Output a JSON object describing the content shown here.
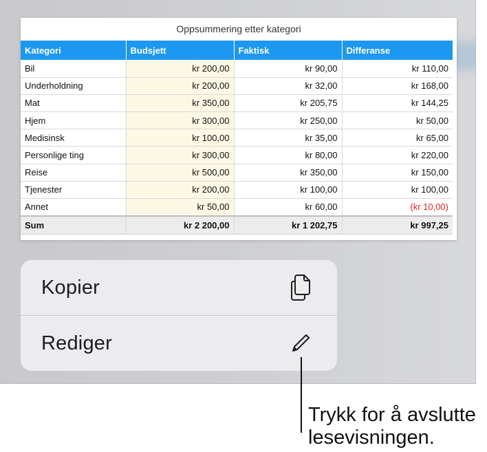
{
  "table": {
    "title": "Oppsummering etter kategori",
    "columns": [
      "Kategori",
      "Budsjett",
      "Faktisk",
      "Differanse"
    ],
    "rows": [
      {
        "category": "Bil",
        "budget": "kr 200,00",
        "actual": "kr 90,00",
        "difference": "kr 110,00"
      },
      {
        "category": "Underholdning",
        "budget": "kr 200,00",
        "actual": "kr 32,00",
        "difference": "kr 168,00"
      },
      {
        "category": "Mat",
        "budget": "kr 350,00",
        "actual": "kr 205,75",
        "difference": "kr 144,25"
      },
      {
        "category": "Hjem",
        "budget": "kr 300,00",
        "actual": "kr 250,00",
        "difference": "kr 50,00"
      },
      {
        "category": "Medisinsk",
        "budget": "kr 100,00",
        "actual": "kr 35,00",
        "difference": "kr 65,00"
      },
      {
        "category": "Personlige ting",
        "budget": "kr 300,00",
        "actual": "kr 80,00",
        "difference": "kr 220,00"
      },
      {
        "category": "Reise",
        "budget": "kr 500,00",
        "actual": "kr 350,00",
        "difference": "kr 150,00"
      },
      {
        "category": "Tjenester",
        "budget": "kr 200,00",
        "actual": "kr 100,00",
        "difference": "kr 100,00"
      },
      {
        "category": "Annet",
        "budget": "kr 50,00",
        "actual": "kr 60,00",
        "difference": "(kr 10,00)",
        "negative": true
      }
    ],
    "total": {
      "category": "Sum",
      "budget": "kr 2 200,00",
      "actual": "kr 1 202,75",
      "difference": "kr 997,25"
    },
    "header_color": "#1d98f0",
    "negative_color": "#e02020"
  },
  "menu": {
    "copy_label": "Kopier",
    "copy_icon": "copy-icon",
    "edit_label": "Rediger",
    "edit_icon": "pencil-icon"
  },
  "callout": {
    "line1": "Trykk for å avslutte",
    "line2": "lesevisningen."
  }
}
